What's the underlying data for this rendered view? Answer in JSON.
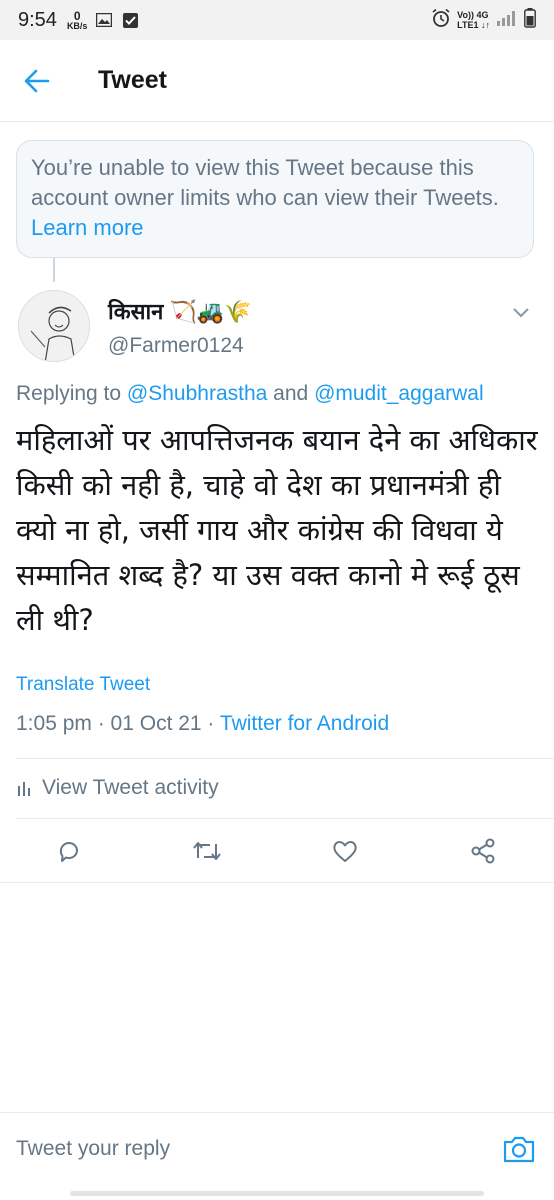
{
  "status_bar": {
    "time": "9:54",
    "net_speed_value": "0",
    "net_speed_unit": "KB/s",
    "network_top": "Vo)) 4G",
    "network_bottom": "LTE1 ↓↑"
  },
  "header": {
    "title": "Tweet",
    "back_icon": "arrow-left-icon"
  },
  "notice": {
    "text": "You’re unable to view this Tweet because this account owner limits who can view their Tweets.",
    "link": "Learn more"
  },
  "tweet": {
    "author_name": "किसान 🏹🚜🌾",
    "author_handle": "@Farmer0124",
    "replying_prefix": "Replying to",
    "replying_user1": "@Shubhrastha",
    "replying_and": "and",
    "replying_user2": "@mudit_aggarwal",
    "text": "महिलाओं पर आपत्तिजनक बयान देने का अधिकार किसी को नही है, चाहे वो देश का प्रधानमंत्री ही क्यो ना हो, जर्सी गाय और कांग्रेस की विधवा ये सम्मानित शब्द है? या उस वक्त कानो मे रूई ठूस ली थी?",
    "translate": "Translate Tweet",
    "timestamp": "1:05 pm · 01 Oct 21 ·",
    "source": "Twitter for Android",
    "activity": "View Tweet activity"
  },
  "actions": [
    "reply-icon",
    "retweet-icon",
    "like-icon",
    "share-icon"
  ],
  "reply_bar": {
    "placeholder": "Tweet your reply"
  },
  "colors": {
    "accent": "#1d9bf0",
    "muted": "#657786",
    "text": "#14171a",
    "notice_bg": "#f5f8fa"
  }
}
